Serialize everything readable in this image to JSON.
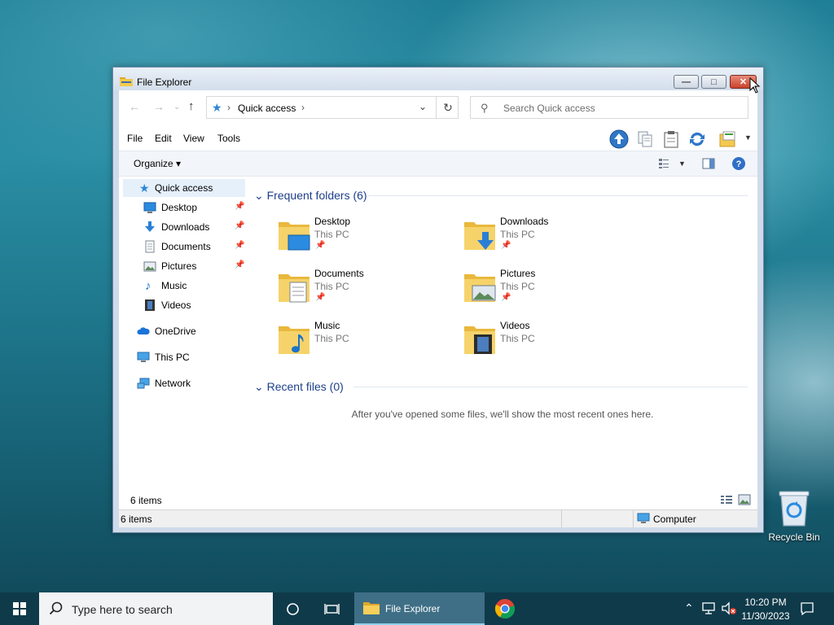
{
  "window": {
    "title": "File Explorer",
    "min_glyph": "—",
    "max_glyph": "□",
    "close_glyph": "✕"
  },
  "address": {
    "location": "Quick access",
    "refresh_glyph": "↻",
    "dropdown_glyph": "⌄",
    "sep": "›"
  },
  "search": {
    "placeholder": "Search Quick access"
  },
  "menu": {
    "file": "File",
    "edit": "Edit",
    "view": "View",
    "tools": "Tools"
  },
  "command": {
    "organize": "Organize ▾"
  },
  "nav": {
    "quick_access": "Quick access",
    "desktop": "Desktop",
    "downloads": "Downloads",
    "documents": "Documents",
    "pictures": "Pictures",
    "music": "Music",
    "videos": "Videos",
    "onedrive": "OneDrive",
    "this_pc": "This PC",
    "network": "Network",
    "pin_glyph": "📌"
  },
  "frequent": {
    "header": "Frequent folders (6)",
    "items": [
      {
        "name": "Desktop",
        "location": "This PC",
        "pinned": true
      },
      {
        "name": "Downloads",
        "location": "This PC",
        "pinned": true
      },
      {
        "name": "Documents",
        "location": "This PC",
        "pinned": true
      },
      {
        "name": "Pictures",
        "location": "This PC",
        "pinned": true
      },
      {
        "name": "Music",
        "location": "This PC",
        "pinned": false
      },
      {
        "name": "Videos",
        "location": "This PC",
        "pinned": false
      }
    ]
  },
  "recent": {
    "header": "Recent files (0)",
    "empty_message": "After you've opened some files, we'll show the most recent ones here."
  },
  "details": {
    "count": "6 items"
  },
  "status": {
    "count": "6 items",
    "location": "Computer"
  },
  "desktop_icons": {
    "recycle_bin": "Recycle Bin"
  },
  "taskbar": {
    "search_placeholder": "Type here to search",
    "explorer_label": "File Explorer",
    "time": "10:20 PM",
    "date": "11/30/2023"
  },
  "colors": {
    "accent": "#1e3f8a",
    "selection": "#e5f0fb",
    "folder": "#f3c94f"
  }
}
